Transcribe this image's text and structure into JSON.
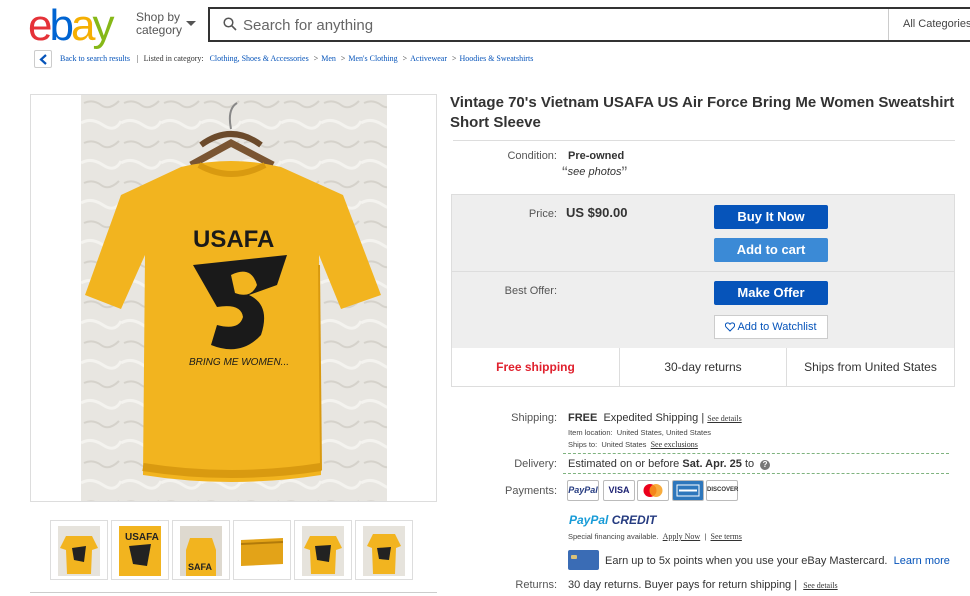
{
  "header": {
    "logo": [
      "e",
      "b",
      "a",
      "y"
    ],
    "logo_colors": [
      "#e53238",
      "#0064d2",
      "#f5af02",
      "#86b817"
    ],
    "shop_by": "Shop by",
    "category": "category",
    "search_placeholder": "Search for anything",
    "all_categories": "All Categories"
  },
  "breadcrumb": {
    "back": "Back to search results",
    "listed_in": "Listed in category:",
    "items": [
      "Clothing, Shoes & Accessories",
      "Men",
      "Men's Clothing",
      "Activewear",
      "Hoodies & Sweatshirts"
    ]
  },
  "photo": {
    "shirt_text_top": "USAFA",
    "shirt_text_bottom": "BRING ME WOMEN..."
  },
  "thumbnails": [
    "thumb-1",
    "thumb-2",
    "thumb-3",
    "thumb-4",
    "thumb-5",
    "thumb-6"
  ],
  "item": {
    "title": "Vintage 70's Vietnam USAFA US Air Force Bring Me Women Sweatshirt Short Sleeve",
    "condition_label": "Condition:",
    "condition": "Pre-owned",
    "condition_note": "see photos",
    "price_label": "Price:",
    "price": "US $90.00",
    "best_offer_label": "Best Offer:"
  },
  "buttons": {
    "buy_now": "Buy It Now",
    "add_to_cart": "Add to cart",
    "make_offer": "Make Offer",
    "watchlist": "Add to Watchlist"
  },
  "features": {
    "shipping": "Free shipping",
    "returns": "30-day returns",
    "ships_from": "Ships from United States"
  },
  "shipping": {
    "label": "Shipping:",
    "free": "FREE",
    "method": "Expedited Shipping |",
    "see_details": "See details",
    "location_label": "Item location:",
    "location": "United States, United States",
    "ships_to_label": "Ships to:",
    "ships_to": "United States",
    "see_exclusions": "See exclusions"
  },
  "delivery": {
    "label": "Delivery:",
    "text": "Estimated on or before",
    "date": "Sat. Apr. 25",
    "to": "to"
  },
  "payments": {
    "label": "Payments:",
    "methods": [
      "PayPal",
      "VISA",
      "MasterCard",
      "AMEX",
      "DISCOVER"
    ],
    "paypal_credit_a": "PayPal",
    "paypal_credit_b": "CREDIT",
    "special_financing": "Special financing available.",
    "apply_now": "Apply Now",
    "see_terms": "See terms",
    "mastercard_promo": "Earn up to 5x points when you use your eBay Mastercard.",
    "learn_more": "Learn more"
  },
  "returns": {
    "label": "Returns:",
    "text": "30 day returns. Buyer pays for return shipping |",
    "see_details": "See details"
  }
}
